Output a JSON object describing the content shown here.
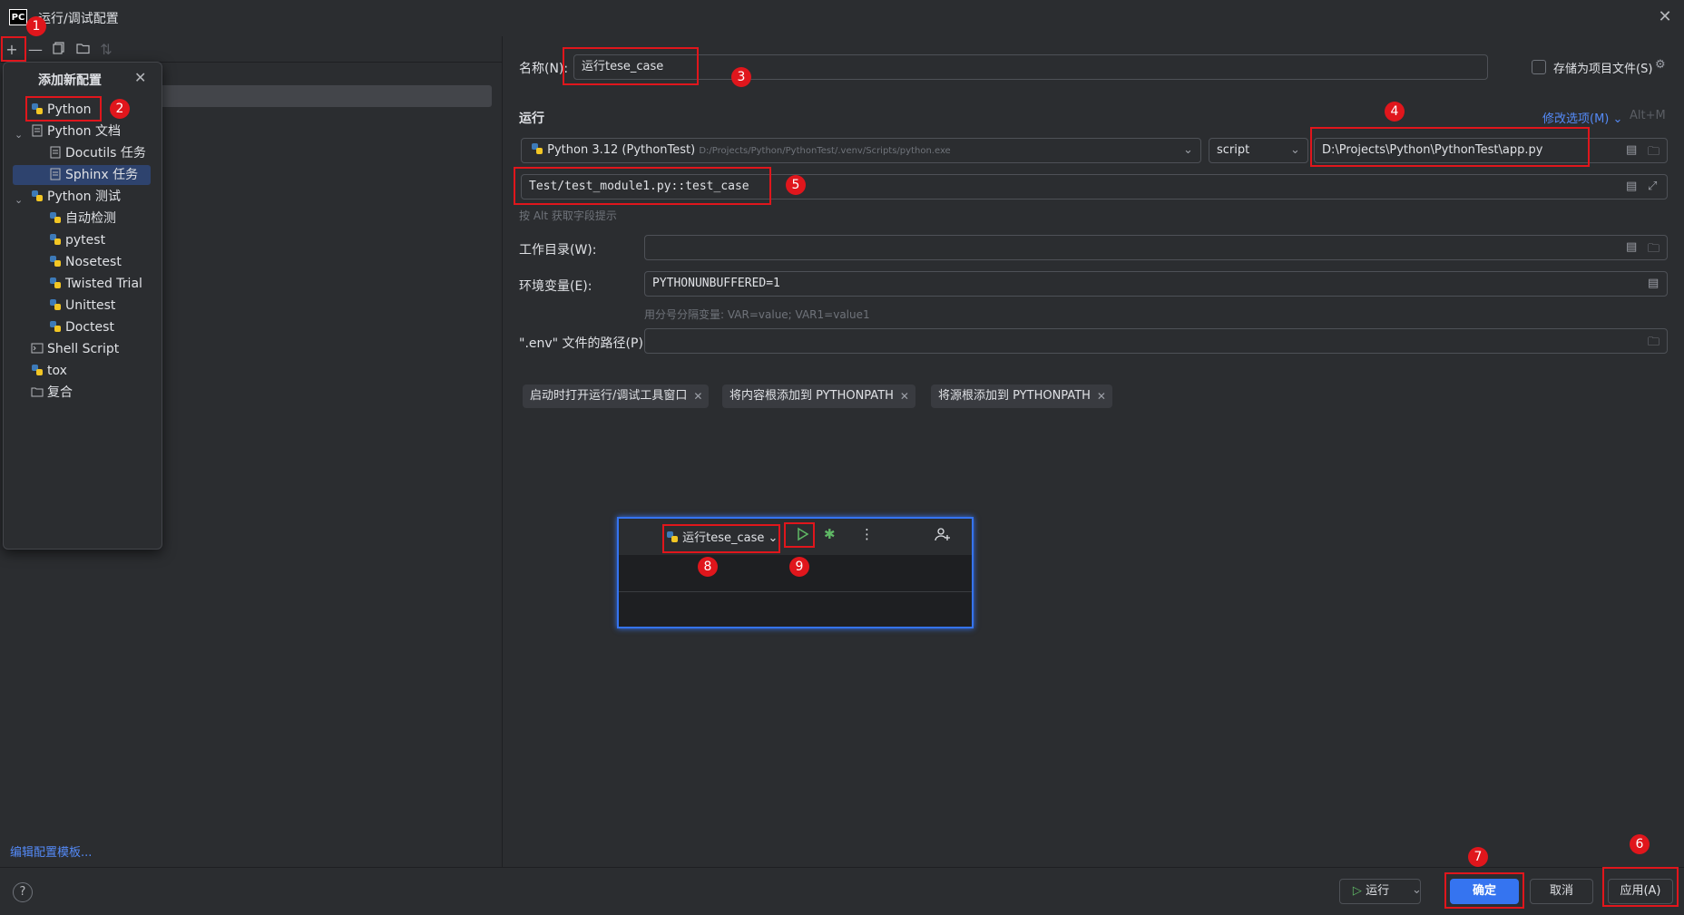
{
  "window": {
    "title": "运行/调试配置",
    "logo": "PC"
  },
  "toolbar": {
    "icons": [
      "add-icon",
      "remove-icon",
      "copy-icon",
      "folder-icon",
      "sort-icon"
    ]
  },
  "popup": {
    "title": "添加新配置",
    "items": [
      {
        "label": "Python",
        "icon": "python-icon"
      },
      {
        "label": "Python 文档",
        "icon": "doc-icon"
      },
      {
        "label": "Docutils 任务",
        "icon": "doc-icon"
      },
      {
        "label": "Sphinx 任务",
        "icon": "doc-icon"
      },
      {
        "label": "Python 测试",
        "icon": "python-icon"
      },
      {
        "label": "自动检测",
        "icon": "python-test-icon"
      },
      {
        "label": "pytest",
        "icon": "python-test-icon"
      },
      {
        "label": "Nosetest",
        "icon": "python-test-icon"
      },
      {
        "label": "Twisted Trial",
        "icon": "python-test-icon"
      },
      {
        "label": "Unittest",
        "icon": "python-test-icon"
      },
      {
        "label": "Doctest",
        "icon": "python-test-icon"
      },
      {
        "label": "Shell Script",
        "icon": "shell-icon"
      },
      {
        "label": "tox",
        "icon": "python-icon"
      },
      {
        "label": "复合",
        "icon": "compound-icon"
      }
    ]
  },
  "left": {
    "edit_templates": "编辑配置模板..."
  },
  "form": {
    "name_label": "名称(N):",
    "name_value": "运行tese_case",
    "store_label": "存储为项目文件(S)",
    "run_section": "运行",
    "modify_options": "修改选项(M)",
    "modify_shortcut": "Alt+M",
    "interpreter": "Python 3.12 (PythonTest)",
    "interpreter_path": "D:/Projects/Python/PythonTest/.venv/Scripts/python.exe",
    "script_type": "script",
    "script_path": "D:\\Projects\\Python\\PythonTest\\app.py",
    "params_value": "Test/test_module1.py::test_case",
    "alt_hint": "按 Alt 获取字段提示",
    "workdir_label": "工作目录(W):",
    "workdir_value": "",
    "env_label": "环境变量(E):",
    "env_value": "PYTHONUNBUFFERED=1",
    "env_hint": "用分号分隔变量: VAR=value; VAR1=value1",
    "dotenv_label": "\".env\" 文件的路径(P):",
    "dotenv_value": "",
    "chips": [
      "启动时打开运行/调试工具窗口",
      "将内容根添加到 PYTHONPATH",
      "将源根添加到 PYTHONPATH"
    ]
  },
  "inset": {
    "config_name": "运行tese_case"
  },
  "buttons": {
    "run": "运行",
    "ok": "确定",
    "cancel": "取消",
    "apply": "应用(A)",
    "help": "?"
  },
  "annotations": [
    "1",
    "2",
    "3",
    "4",
    "5",
    "6",
    "7",
    "8",
    "9"
  ],
  "colors": {
    "accent": "#3574f0",
    "annotation": "#e0161c",
    "background": "#2b2d30"
  }
}
